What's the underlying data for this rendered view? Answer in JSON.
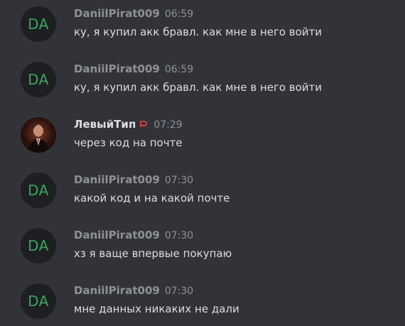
{
  "messages": [
    {
      "author": "DaniilPirat009",
      "avatar_initials": "DA",
      "time": "06:59",
      "text": "ку, я купил акк бравл. как мне в него войти"
    },
    {
      "author": "DaniilPirat009",
      "avatar_initials": "DA",
      "time": "06:59",
      "text": "ку, я купил акк бравл. как мне в него войти"
    },
    {
      "author": "ЛевыйТип",
      "avatar_icon": "user-photo",
      "role_icon": "shield-role-icon",
      "time": "07:29",
      "text": "через код на почте"
    },
    {
      "author": "DaniilPirat009",
      "avatar_initials": "DA",
      "time": "07:30",
      "text": "какой код и на какой почте"
    },
    {
      "author": "DaniilPirat009",
      "avatar_initials": "DA",
      "time": "07:30",
      "text": "хз я ваще впервые покупаю"
    },
    {
      "author": "DaniilPirat009",
      "avatar_initials": "DA",
      "time": "07:30",
      "text": "мне данных никаких не дали"
    }
  ],
  "colors": {
    "background": "#313338",
    "avatar_bg": "#1e1f22",
    "initials": "#3ba55c",
    "username": "#8e9297",
    "text": "#dcddde",
    "role_icon": "#ed4245"
  }
}
